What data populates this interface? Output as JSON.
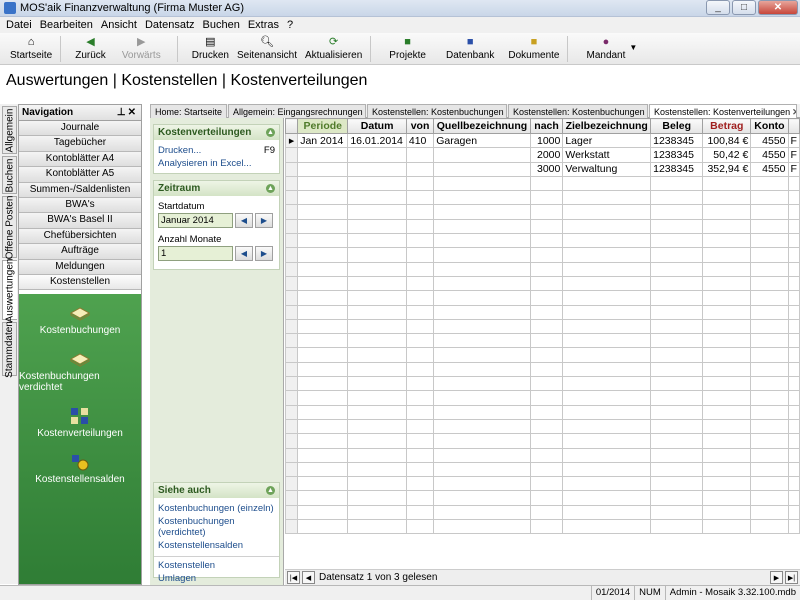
{
  "window": {
    "title": "MOS'aik Finanzverwaltung (Firma Muster AG)"
  },
  "menu": [
    "Datei",
    "Bearbeiten",
    "Ansicht",
    "Datensatz",
    "Buchen",
    "Extras",
    "?"
  ],
  "toolbar": {
    "startseite": "Startseite",
    "zurueck": "Zurück",
    "vorwaerts": "Vorwärts",
    "drucken": "Drucken",
    "seitenansicht": "Seitenansicht",
    "aktualisieren": "Aktualisieren",
    "projekte": "Projekte",
    "datenbank": "Datenbank",
    "dokumente": "Dokumente",
    "mandant": "Mandant"
  },
  "page_title": "Auswertungen | Kostenstellen | Kostenverteilungen",
  "vertical_tabs": [
    "Allgemein",
    "Buchen",
    "Offene Posten",
    "Auswertungen",
    "Stammdaten"
  ],
  "navigation": {
    "title": "Navigation",
    "items": [
      "Journale",
      "Tagebücher",
      "Kontoblätter A4",
      "Kontoblätter A5",
      "Summen-/Saldenlisten",
      "BWA's",
      "BWA's Basel II",
      "Chefübersichten",
      "Aufträge",
      "Meldungen",
      "Kostenstellen"
    ],
    "green_items": [
      "Kostenbuchungen",
      "Kostenbuchungen verdichtet",
      "Kostenverteilungen",
      "Kostenstellensalden"
    ]
  },
  "tabs": [
    "Home: Startseite",
    "Allgemein: Eingangsrechnungen",
    "Kostenstellen: Kostenbuchungen",
    "Kostenstellen: Kostenbuchungen ve",
    "Kostenstellen: Kostenverteilungen"
  ],
  "sidepanel": {
    "kv_title": "Kostenverteilungen",
    "drucken": "Drucken...",
    "drucken_key": "F9",
    "analysieren": "Analysieren in Excel...",
    "zeitraum_title": "Zeitraum",
    "startdatum_label": "Startdatum",
    "startdatum_value": "Januar 2014",
    "monate_label": "Anzahl Monate",
    "monate_value": "1",
    "siehe_title": "Siehe auch",
    "siehe_links": [
      "Kostenbuchungen (einzeln)",
      "Kostenbuchungen (verdichtet)",
      "Kostenstellensalden"
    ],
    "extra_links": [
      "Kostenstellen",
      "Umlagen"
    ]
  },
  "grid": {
    "headers": [
      "Periode",
      "Datum",
      "von",
      "Quellbezeichnung",
      "nach",
      "Zielbezeichnung",
      "Beleg",
      "Betrag",
      "Konto",
      ""
    ],
    "rows": [
      [
        "Jan 2014",
        "16.01.2014",
        "410",
        "Garagen",
        "1000",
        "Lager",
        "1238345",
        "100,84 €",
        "4550",
        "F"
      ],
      [
        "",
        "",
        "",
        "",
        "2000",
        "Werkstatt",
        "1238345",
        "50,42 €",
        "4550",
        "F"
      ],
      [
        "",
        "",
        "",
        "",
        "3000",
        "Verwaltung",
        "1238345",
        "352,94 €",
        "4550",
        "F"
      ]
    ],
    "record_status": "Datensatz 1 von 3 gelesen"
  },
  "status": {
    "period": "01/2014",
    "num": "NUM",
    "user": "Admin - Mosaik 3.32.100.mdb"
  }
}
